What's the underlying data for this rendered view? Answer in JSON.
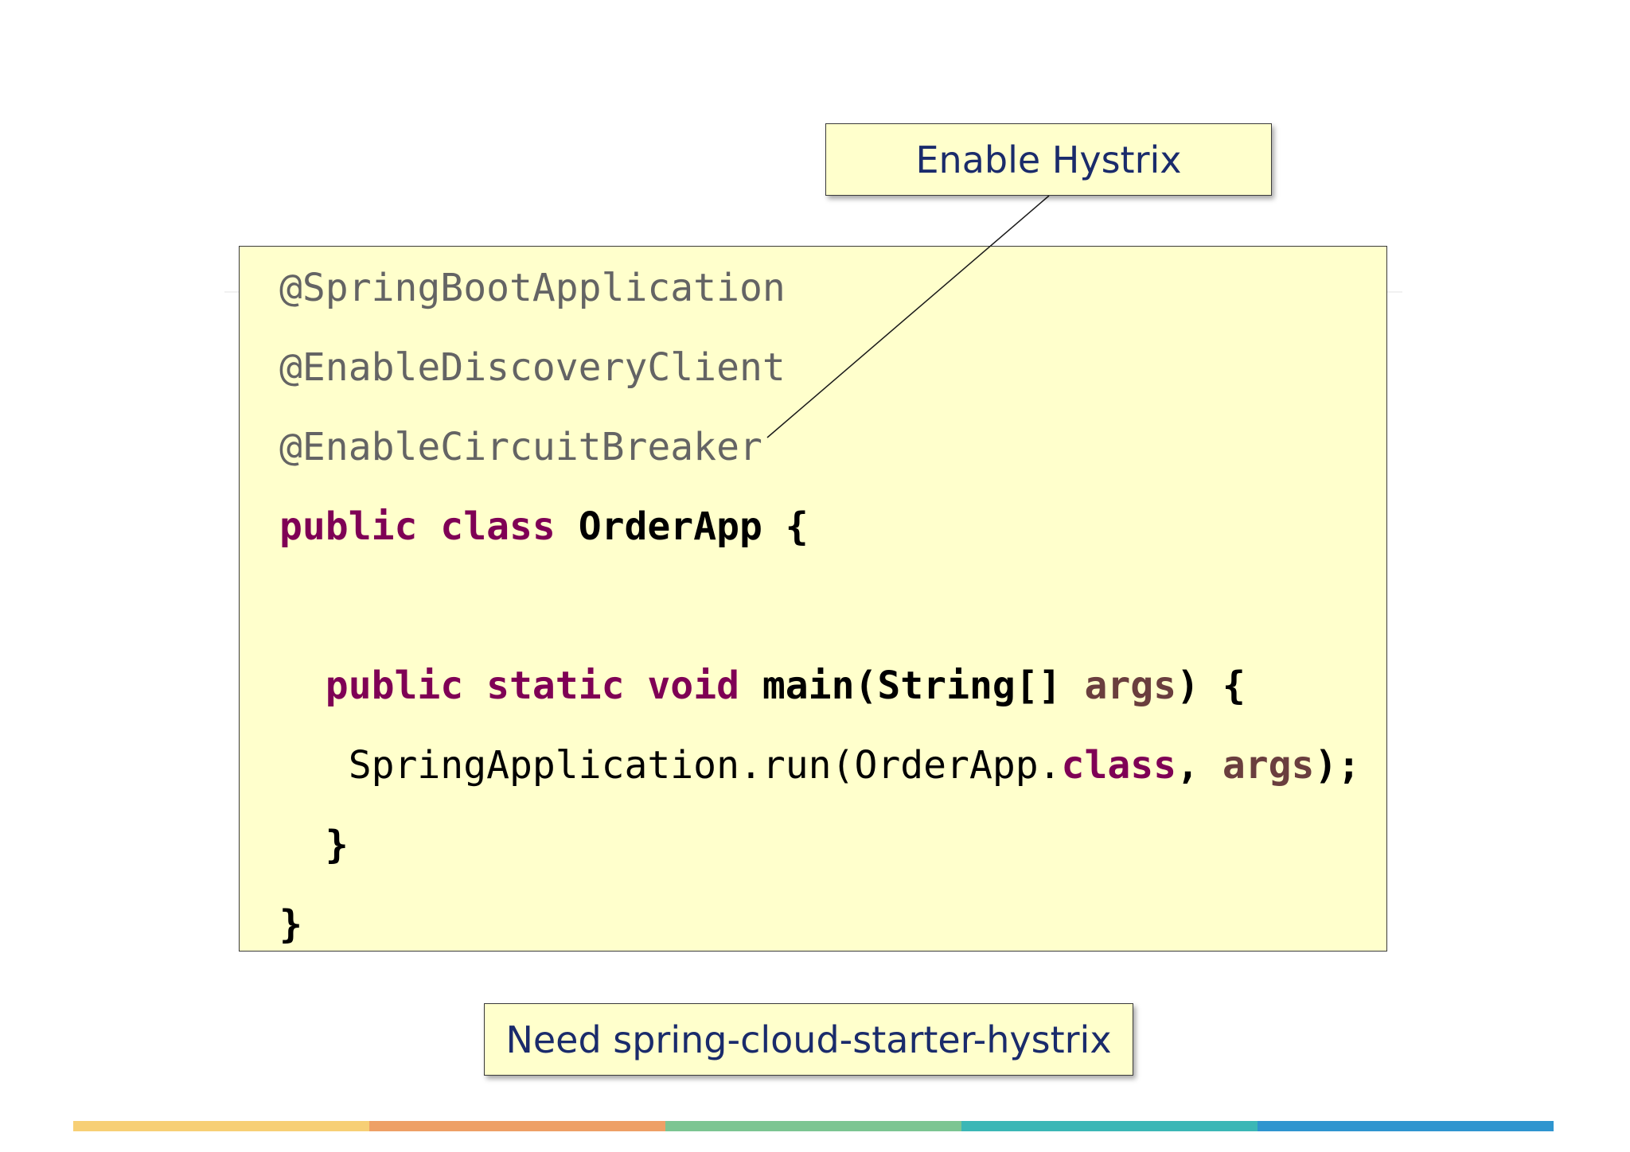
{
  "code": {
    "lines": [
      {
        "id": "annot-1",
        "segments": [
          {
            "text": "@SpringBootApplication",
            "style": "annotation"
          }
        ]
      },
      {
        "id": "annot-2",
        "segments": [
          {
            "text": "@EnableDiscoveryClient",
            "style": "annotation"
          }
        ]
      },
      {
        "id": "annot-3",
        "segments": [
          {
            "text": "@EnableCircuitBreaker",
            "style": "annotation"
          }
        ]
      },
      {
        "id": "class-decl",
        "segments": [
          {
            "text": "public",
            "style": "kw"
          },
          {
            "text": " ",
            "style": "plain"
          },
          {
            "text": "class",
            "style": "kw"
          },
          {
            "text": " OrderApp {",
            "style": "plain-bold"
          }
        ]
      },
      {
        "id": "blank",
        "segments": []
      },
      {
        "id": "main-decl",
        "segments": [
          {
            "text": "  public",
            "style": "kw"
          },
          {
            "text": " ",
            "style": "plain"
          },
          {
            "text": "static",
            "style": "kw"
          },
          {
            "text": " ",
            "style": "plain"
          },
          {
            "text": "void",
            "style": "kw"
          },
          {
            "text": " main(String[] ",
            "style": "plain-bold"
          },
          {
            "text": "args",
            "style": "param"
          },
          {
            "text": ") {",
            "style": "plain-bold"
          }
        ]
      },
      {
        "id": "run-call",
        "segments": [
          {
            "text": "   SpringApplication.run(OrderApp.",
            "style": "plain"
          },
          {
            "text": "class",
            "style": "kw"
          },
          {
            "text": ", ",
            "style": "plain-bold"
          },
          {
            "text": "args",
            "style": "param"
          },
          {
            "text": ");",
            "style": "plain-bold"
          }
        ]
      },
      {
        "id": "main-close",
        "segments": [
          {
            "text": "  }",
            "style": "plain-bold"
          }
        ]
      },
      {
        "id": "class-close",
        "segments": [
          {
            "text": "}",
            "style": "plain-bold"
          }
        ]
      }
    ]
  },
  "callouts": {
    "top": "Enable Hystrix",
    "bottom": "Need spring-cloud-starter-hystrix"
  },
  "footer": {
    "colors": [
      "#f7cf75",
      "#eea066",
      "#7cc592",
      "#3bb7b6",
      "#2f95cf"
    ]
  }
}
